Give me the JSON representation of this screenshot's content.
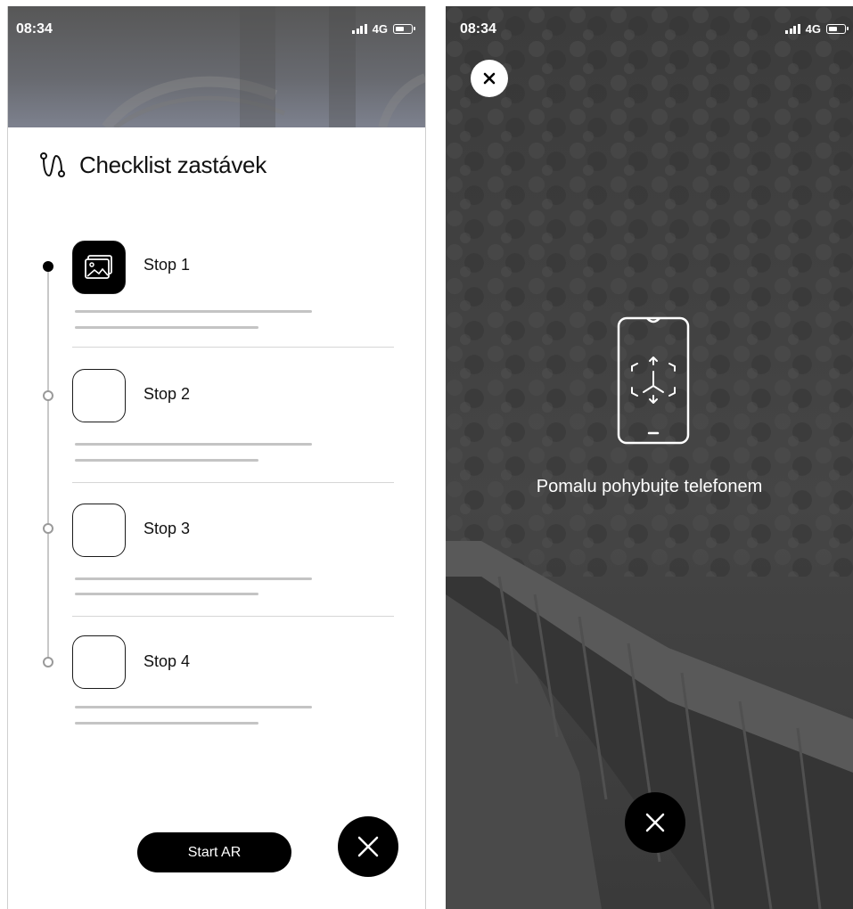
{
  "status_bar": {
    "time": "08:34",
    "network": "4G"
  },
  "checklist": {
    "title": "Checklist zastávek",
    "stops": [
      {
        "label": "Stop 1",
        "active": true
      },
      {
        "label": "Stop 2",
        "active": false
      },
      {
        "label": "Stop 3",
        "active": false
      },
      {
        "label": "Stop 4",
        "active": false
      }
    ],
    "start_ar_label": "Start AR"
  },
  "ar_screen": {
    "hint": "Pomalu pohybujte telefonem"
  },
  "icons": {
    "route": "route-icon",
    "image": "image-icon",
    "close": "close-icon",
    "phone_ar": "phone-ar-scan-icon"
  }
}
